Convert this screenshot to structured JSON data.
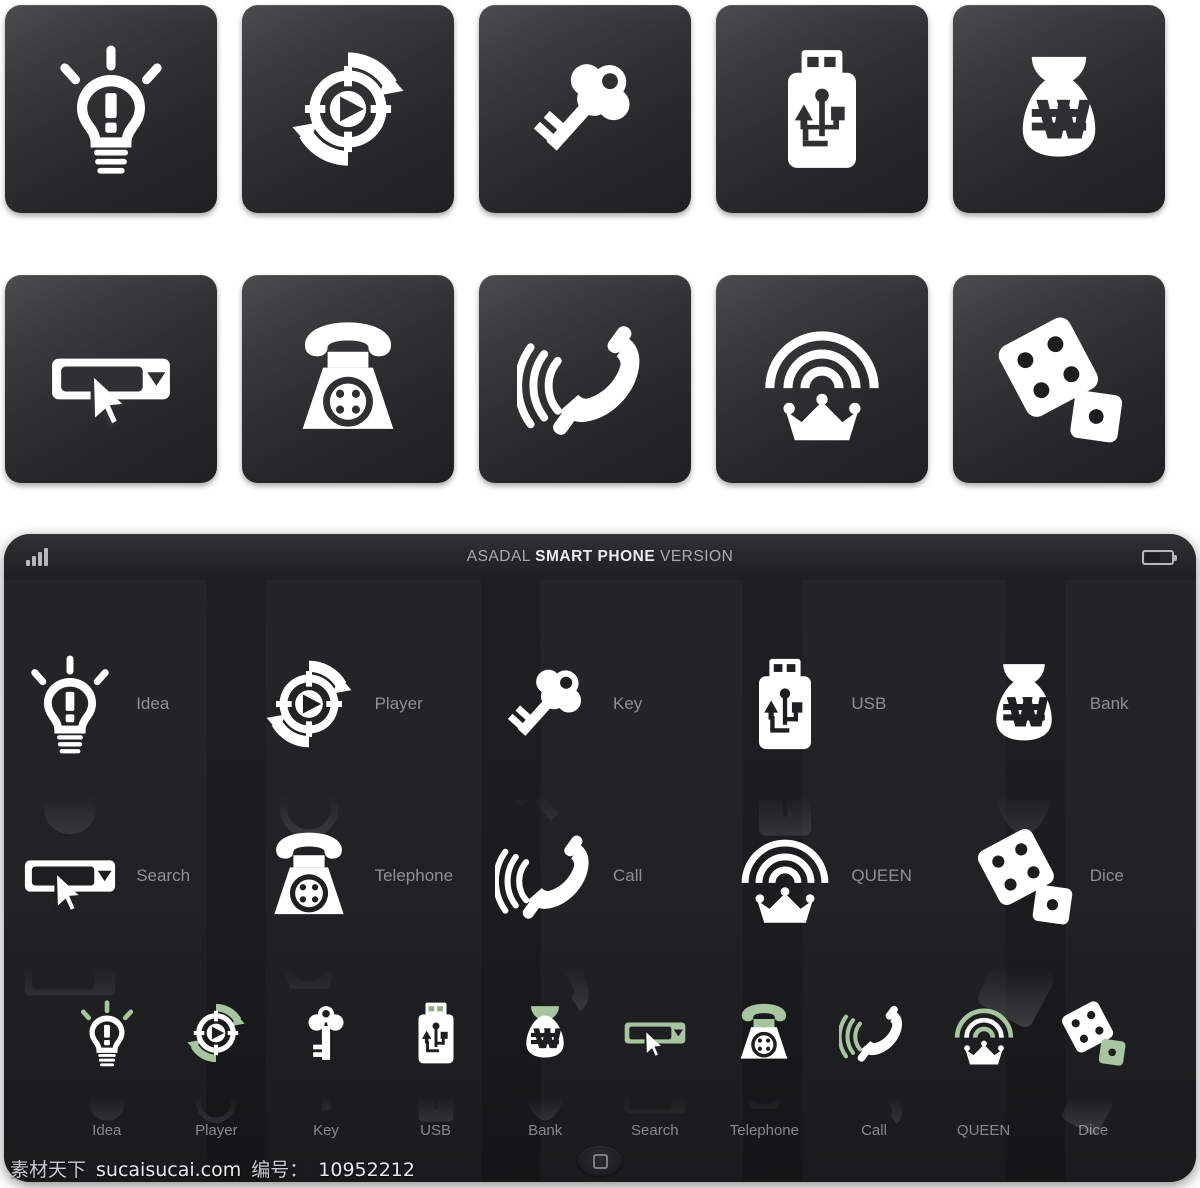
{
  "device": {
    "status_bar": {
      "signal_icon": "signal-bars-icon",
      "title_prefix": "ASADAL",
      "title_strong": "SMART PHONE",
      "title_suffix": "VERSION",
      "battery_icon": "battery-icon"
    },
    "home_button_label": "home-button"
  },
  "colors": {
    "tile_dark": "#2e3032",
    "icon_white": "#ffffff",
    "accent_green": "#a9c4a0",
    "screen_bg": "#1d1f21",
    "label_gray": "#8e9092"
  },
  "icons": [
    {
      "id": "idea",
      "label": "Idea",
      "icon": "lightbulb-idea-icon"
    },
    {
      "id": "player",
      "label": "Player",
      "icon": "media-player-refresh-icon"
    },
    {
      "id": "key",
      "label": "Key",
      "icon": "key-icon"
    },
    {
      "id": "usb",
      "label": "USB",
      "icon": "usb-flash-drive-icon"
    },
    {
      "id": "bank",
      "label": "Bank",
      "icon": "money-bag-won-icon"
    },
    {
      "id": "search",
      "label": "Search",
      "icon": "search-dropdown-cursor-icon"
    },
    {
      "id": "telephone",
      "label": "Telephone",
      "icon": "rotary-telephone-icon"
    },
    {
      "id": "call",
      "label": "Call",
      "icon": "phone-handset-ringing-icon"
    },
    {
      "id": "queen",
      "label": "QUEEN",
      "icon": "crown-signal-icon"
    },
    {
      "id": "dice",
      "label": "Dice",
      "icon": "dice-pair-icon"
    }
  ],
  "watermark": {
    "brand": "素材天下",
    "site": "sucaisucai.com",
    "id_label": "编号：",
    "id_value": "10952212"
  }
}
